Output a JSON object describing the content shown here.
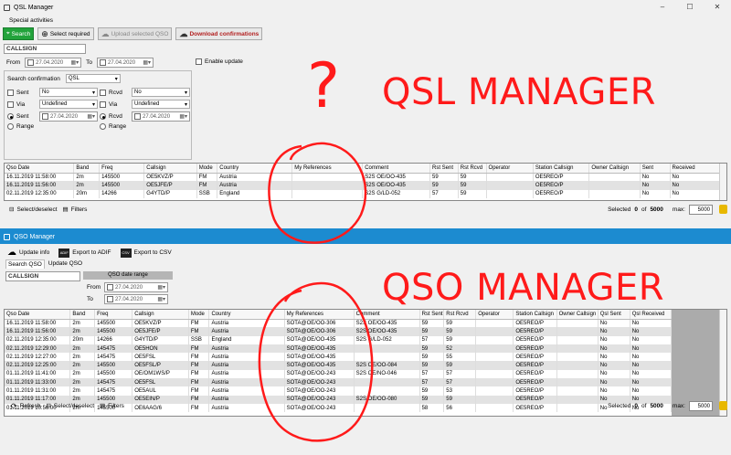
{
  "qsl": {
    "window_title": "QSL Manager",
    "menu": "Special activities",
    "toolbar": {
      "search": "Search",
      "select_required": "Select required",
      "upload": "Upload selected QSO",
      "download": "Download confirmations"
    },
    "callsign": "CALLSIGN",
    "from_label": "From",
    "to_label": "To",
    "from_date": "27.04.2020",
    "to_date": "27.04.2020",
    "enable_update": "Enable update",
    "search_confirmation_label": "Search confirmation",
    "search_confirmation_value": "QSL",
    "sent_label": "Sent",
    "rcvd_label": "Rcvd",
    "via_label": "Via",
    "range_label": "Range",
    "sent_value": "No",
    "rcvd_value": "No",
    "via_sent_value": "Undefined",
    "via_rcvd_value": "Undefined",
    "sent_date": "27.04.2020",
    "rcvd_date": "27.04.2020",
    "columns": [
      "Qso Date",
      "Band",
      "Freq",
      "Callsign",
      "Mode",
      "Country",
      "My References",
      "Comment",
      "Rst Sent",
      "Rst Rcvd",
      "Operator",
      "Station Callsign",
      "Owner Callsign",
      "Sent",
      "Received"
    ],
    "rows": [
      [
        "16.11.2019 11:58:00",
        "2m",
        "145500",
        "OE5KVZ/P",
        "FM",
        "Austria",
        "",
        "S2S OE/OO-435",
        "59",
        "59",
        "",
        "OE5REO/P",
        "",
        "No",
        "No"
      ],
      [
        "16.11.2019 11:56:00",
        "2m",
        "145500",
        "OE5JFE/P",
        "FM",
        "Austria",
        "",
        "S2S OE/OO-435",
        "59",
        "59",
        "",
        "OE5REO/P",
        "",
        "No",
        "No"
      ],
      [
        "02.11.2019 12:35:00",
        "20m",
        "14266",
        "G4YTD/P",
        "SSB",
        "England",
        "",
        "S2S G/LD-052",
        "57",
        "59",
        "",
        "OE5REO/P",
        "",
        "No",
        "No"
      ]
    ],
    "status_left_1": "Select/deselect",
    "status_left_2": "Filters",
    "selected_label": "Selected",
    "selected_count": "0",
    "of_label": "of",
    "total": "5000",
    "max_label": "max:",
    "max_value": "5000"
  },
  "qso": {
    "window_title": "QSO Manager",
    "toolbar": {
      "update_info": "Update info",
      "export_adif": "Export to ADIF",
      "export_csv": "Export to CSV"
    },
    "tabs": [
      "Search QSO",
      "Update QSO"
    ],
    "callsign": "CALLSIGN",
    "date_range_label": "QSO date range",
    "from_label": "From",
    "to_label": "To",
    "from_date": "27.04.2020",
    "to_date": "27.04.2020",
    "columns": [
      "Qso Date",
      "Band",
      "Freq",
      "Callsign",
      "Mode",
      "Country",
      "My References",
      "Comment",
      "Rst Sent",
      "Rst Rcvd",
      "Operator",
      "Station Callsign",
      "Owner Callsign",
      "Qsl Sent",
      "Qsl Received"
    ],
    "rows": [
      [
        "16.11.2019 11:58:00",
        "2m",
        "145500",
        "OE5KVZ/P",
        "FM",
        "Austria",
        "SOTA@OE/OO-306",
        "S2S OE/OO-435",
        "59",
        "59",
        "",
        "OE5REO/P",
        "",
        "No",
        "No"
      ],
      [
        "16.11.2019 11:56:00",
        "2m",
        "145500",
        "OE5JFE/P",
        "FM",
        "Austria",
        "SOTA@OE/OO-306",
        "S2S OE/OO-435",
        "59",
        "59",
        "",
        "OE5REO/P",
        "",
        "No",
        "No"
      ],
      [
        "02.11.2019 12:35:00",
        "20m",
        "14266",
        "G4YTD/P",
        "SSB",
        "England",
        "SOTA@OE/OO-435",
        "S2S G/LD-052",
        "57",
        "59",
        "",
        "OE5REO/P",
        "",
        "No",
        "No"
      ],
      [
        "02.11.2019 12:29:00",
        "2m",
        "145475",
        "OE5HON",
        "FM",
        "Austria",
        "SOTA@OE/OO-435",
        "",
        "59",
        "52",
        "",
        "OE5REO/P",
        "",
        "No",
        "No"
      ],
      [
        "02.11.2019 12:27:00",
        "2m",
        "145475",
        "OE5FSL",
        "FM",
        "Austria",
        "SOTA@OE/OO-435",
        "",
        "59",
        "55",
        "",
        "OE5REO/P",
        "",
        "No",
        "No"
      ],
      [
        "02.11.2019 12:25:00",
        "2m",
        "145500",
        "OE5FSL/P",
        "FM",
        "Austria",
        "SOTA@OE/OO-435",
        "S2S OE/OO-084",
        "59",
        "59",
        "",
        "OE5REO/P",
        "",
        "No",
        "No"
      ],
      [
        "01.11.2019 11:41:00",
        "2m",
        "145500",
        "OE/OM1WS/P",
        "FM",
        "Austria",
        "SOTA@OE/OO-243",
        "S2S OE/NO-046",
        "57",
        "57",
        "",
        "OE5REO/P",
        "",
        "No",
        "No"
      ],
      [
        "01.11.2019 11:33:00",
        "2m",
        "145475",
        "OE5FSL",
        "FM",
        "Austria",
        "SOTA@OE/OO-243",
        "",
        "57",
        "57",
        "",
        "OE5REO/P",
        "",
        "No",
        "No"
      ],
      [
        "01.11.2019 11:31:00",
        "2m",
        "145475",
        "OE5AUL",
        "FM",
        "Austria",
        "SOTA@OE/OO-243",
        "",
        "59",
        "53",
        "",
        "OE5REO/P",
        "",
        "No",
        "No"
      ],
      [
        "01.11.2019 11:17:00",
        "2m",
        "145500",
        "OE5EIN/P",
        "FM",
        "Austria",
        "SOTA@OE/OO-243",
        "S2S OE/OO-080",
        "59",
        "59",
        "",
        "OE5REO/P",
        "",
        "No",
        "No"
      ],
      [
        "01.11.2019 10:56:00",
        "2m",
        "145500",
        "OE6AAG/6",
        "FM",
        "Austria",
        "SOTA@OE/OO-243",
        "",
        "58",
        "56",
        "",
        "OE5REO/P",
        "",
        "No",
        "No"
      ]
    ],
    "status_refresh": "Refresh",
    "status_left_1": "Select/deselect",
    "status_left_2": "Filters",
    "selected_label": "Selected",
    "selected_count": "0",
    "of_label": "of",
    "total": "5000",
    "max_label": "max:",
    "max_value": "5000"
  },
  "annotations": {
    "question_mark": "?",
    "qsl_label": "QSL MANAGER",
    "qso_label": "QSO MANAGER",
    "color": "#ff1a1a"
  }
}
